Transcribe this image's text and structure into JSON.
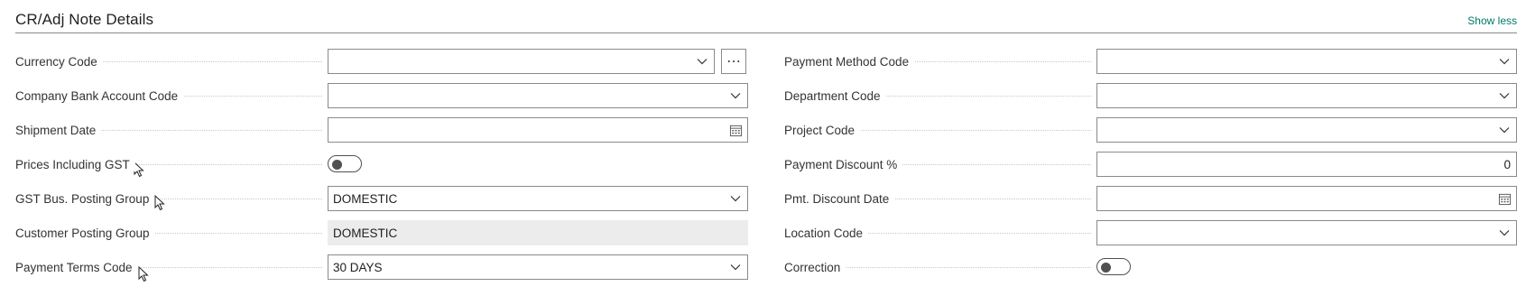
{
  "header": {
    "title": "CR/Adj Note Details",
    "show_less": "Show less"
  },
  "left": {
    "currency_code": {
      "label": "Currency Code",
      "value": ""
    },
    "company_bank_account_code": {
      "label": "Company Bank Account Code",
      "value": ""
    },
    "shipment_date": {
      "label": "Shipment Date",
      "value": ""
    },
    "prices_including_gst": {
      "label": "Prices Including GST",
      "on": false
    },
    "gst_bus_posting_group": {
      "label": "GST Bus. Posting Group",
      "value": "DOMESTIC"
    },
    "customer_posting_group": {
      "label": "Customer Posting Group",
      "value": "DOMESTIC"
    },
    "payment_terms_code": {
      "label": "Payment Terms Code",
      "value": "30 DAYS"
    }
  },
  "right": {
    "payment_method_code": {
      "label": "Payment Method Code",
      "value": ""
    },
    "department_code": {
      "label": "Department Code",
      "value": ""
    },
    "project_code": {
      "label": "Project Code",
      "value": ""
    },
    "payment_discount_pct": {
      "label": "Payment Discount %",
      "value": "0"
    },
    "pmt_discount_date": {
      "label": "Pmt. Discount Date",
      "value": ""
    },
    "location_code": {
      "label": "Location Code",
      "value": ""
    },
    "correction": {
      "label": "Correction",
      "on": false
    }
  },
  "icons": {
    "dropdown": "chevron-down-icon",
    "calendar": "calendar-icon",
    "more": "ellipsis-icon",
    "cursor": "mouse-pointer-icon"
  },
  "colors": {
    "accent": "#00796b",
    "toggle": "#505050",
    "border": "#8a8a8a",
    "readonly_bg": "#ececec"
  }
}
